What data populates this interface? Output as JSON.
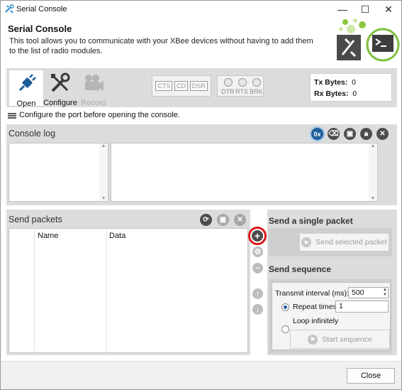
{
  "window": {
    "title": "Serial Console",
    "minimize_glyph": "—",
    "maximize_glyph": "☐",
    "close_glyph": "✕"
  },
  "header": {
    "title": "Serial Console",
    "description": "This tool allows you to communicate with your XBee devices without having to add them to the list of radio modules."
  },
  "toolbar": {
    "open_label": "Open",
    "configure_label": "Configure",
    "record_label": "Record",
    "signals": [
      "CTS",
      "CD",
      "DSR"
    ],
    "leds": [
      "DTR",
      "RTS",
      "BRK"
    ],
    "tx_label": "Tx Bytes:",
    "tx_value": "0",
    "rx_label": "Rx Bytes:",
    "rx_value": "0"
  },
  "status": {
    "message": "Configure the port before opening the console."
  },
  "console_log": {
    "title": "Console log",
    "hex_toggle_label": "0x"
  },
  "send_packets": {
    "title": "Send packets",
    "columns": [
      "Name",
      "Data"
    ]
  },
  "single_packet": {
    "title": "Send a single packet",
    "send_label": "Send selected packet"
  },
  "sequence": {
    "title": "Send sequence",
    "interval_label": "Transmit interval (ms):",
    "interval_value": "500",
    "repeat_label": "Repeat times",
    "repeat_value": "1",
    "loop_label": "Loop infinitely",
    "start_label": "Start sequence"
  },
  "footer": {
    "close_label": "Close"
  },
  "colors": {
    "accent": "#1d5d9a",
    "panel": "#dcdcdc",
    "highlight_ring": "#e0181b",
    "logo_green": "#7fbf3f"
  }
}
